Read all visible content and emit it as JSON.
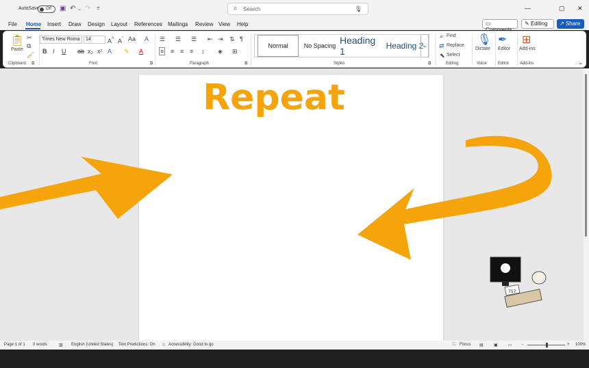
{
  "titlebar": {
    "autosave_label": "AutoSave",
    "autosave_state": "Off",
    "search_placeholder": "Search"
  },
  "menu": {
    "items": [
      "File",
      "Home",
      "Insert",
      "Draw",
      "Design",
      "Layout",
      "References",
      "Mailings",
      "Review",
      "View",
      "Help"
    ],
    "active": "Home"
  },
  "buttons": {
    "comments": "Comments",
    "editing": "Editing",
    "share": "Share"
  },
  "ribbon": {
    "clipboard": {
      "paste": "Paste",
      "label": "Clipboard"
    },
    "font": {
      "family": "Times New Roma",
      "size": "14",
      "label": "Font"
    },
    "paragraph": {
      "label": "Paragraph"
    },
    "styles": {
      "items": [
        "Normal",
        "No Spacing",
        "Heading 1",
        "Heading 2"
      ],
      "label": "Styles"
    },
    "editing": {
      "find": "Find",
      "replace": "Replace",
      "select": "Select",
      "label": "Editing"
    },
    "voice": {
      "dictate": "Dictate",
      "label": "Voice"
    },
    "editor": {
      "editor": "Editor",
      "label": "Editor"
    },
    "addins": {
      "addins": "Add-ins",
      "label": "Add-ins"
    }
  },
  "document": {
    "title_text": "Repeat",
    "sticker_label": "757"
  },
  "statusbar": {
    "page": "Page 1 of 1",
    "words": "0 words",
    "language": "English (United States)",
    "predictions": "Text Predictions: On",
    "accessibility": "Accessibility: Good to go",
    "focus": "Focus",
    "zoom": "100%"
  },
  "colors": {
    "accent": "#185abd",
    "arrow": "#f5a40c"
  }
}
